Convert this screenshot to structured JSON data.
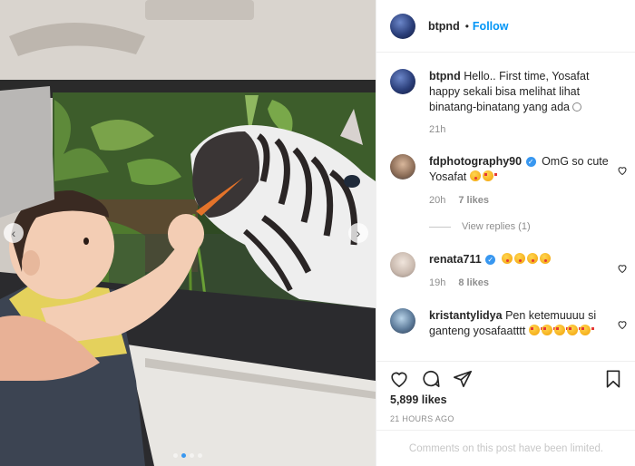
{
  "post": {
    "username": "btpnd",
    "follow_label": "Follow",
    "bullet": "•",
    "caption": "Hello.. First time, Yosafat happy sekali bisa melihat lihat binatang-binatang yang ada",
    "caption_time": "21h",
    "likes": "5,899 likes",
    "timestamp": "21 HOURS AGO",
    "comments_limited": "Comments on this post have been limited."
  },
  "carousel": {
    "total": 4,
    "active_index": 1
  },
  "comments": [
    {
      "username": "fdphotography90",
      "verified": true,
      "text": "OmG so cute Yosafat",
      "emojis": [
        "yum",
        "heart-eyes"
      ],
      "time": "20h",
      "likes": "7 likes",
      "view_replies": "View replies (1)"
    },
    {
      "username": "renata711",
      "verified": true,
      "text": "",
      "emojis": [
        "yum",
        "yum",
        "yum",
        "yum"
      ],
      "time": "19h",
      "likes": "8 likes"
    },
    {
      "username": "kristantylidya",
      "verified": false,
      "text": "Pen ketemuuuu si ganteng yosafaatttt",
      "emojis": [
        "heart-eyes",
        "heart-eyes",
        "heart-eyes",
        "heart-eyes",
        "heart-eyes"
      ],
      "time": "",
      "likes": ""
    }
  ],
  "colors": {
    "accent": "#0095f6",
    "text": "#262626",
    "muted": "#8e8e8e",
    "border": "#efefef"
  },
  "icons": [
    "heart-icon",
    "comment-icon",
    "share-icon",
    "bookmark-icon",
    "verified-badge-icon",
    "chevron-left-icon",
    "chevron-right-icon"
  ]
}
